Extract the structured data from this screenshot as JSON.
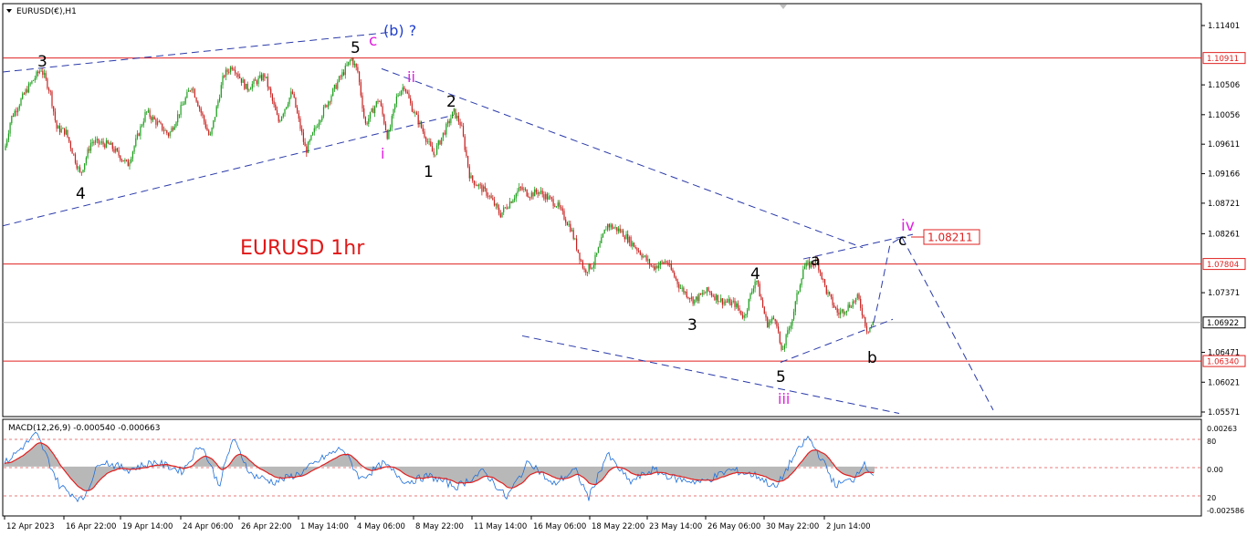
{
  "chart_data": {
    "type": "line",
    "title": "EURUSD(€),H1",
    "annotation_title": "EURUSD 1hr",
    "price_axis": {
      "ticks": [
        "1.11401",
        "1.10506",
        "1.10056",
        "1.09611",
        "1.09166",
        "1.08721",
        "1.08261",
        "1.07371",
        "1.06471",
        "1.06021",
        "1.05571"
      ],
      "ylim": [
        1.05571,
        1.11401
      ],
      "marked_levels": [
        {
          "label": "1.10911",
          "value": 1.10911,
          "color": "#e02020"
        },
        {
          "label": "1.07804",
          "value": 1.07804,
          "color": "#e02020"
        },
        {
          "label": "1.06922",
          "value": 1.06922,
          "color": "#000000"
        },
        {
          "label": "1.06340",
          "value": 1.0634,
          "color": "#e02020"
        }
      ],
      "target_label": "1.08211",
      "target_value": 1.08211
    },
    "time_axis": {
      "ticks": [
        "12 Apr 2023",
        "16 Apr 22:00",
        "19 Apr 14:00",
        "24 Apr 06:00",
        "26 Apr 22:00",
        "1 May 14:00",
        "4 May 06:00",
        "8 May 22:00",
        "11 May 14:00",
        "16 May 06:00",
        "18 May 22:00",
        "23 May 14:00",
        "26 May 06:00",
        "30 May 22:00",
        "2 Jun 14:00"
      ]
    },
    "price_anchors": {
      "x": [
        0,
        12,
        30,
        45,
        55,
        62,
        72,
        88,
        100,
        120,
        140,
        160,
        185,
        210,
        230,
        245,
        255,
        270,
        290,
        305,
        320,
        335,
        350,
        370,
        385,
        392,
        400,
        415,
        425,
        435,
        443,
        450,
        462,
        475,
        485,
        497,
        505,
        515,
        535,
        548,
        570,
        580,
        590,
        610,
        625,
        640,
        650,
        665,
        680,
        700,
        715,
        730,
        745,
        760,
        775,
        790,
        805,
        815,
        828,
        840,
        850,
        856,
        868,
        880,
        895,
        905,
        918,
        928,
        940,
        950,
        957
      ],
      "y": [
        1.0918,
        1.1,
        1.1045,
        1.1075,
        1.104,
        1.0985,
        1.098,
        1.0915,
        1.0965,
        1.096,
        1.093,
        1.101,
        1.0975,
        1.105,
        1.097,
        1.1065,
        1.108,
        1.1045,
        1.1065,
        1.0995,
        1.104,
        1.095,
        1.1,
        1.1055,
        1.109,
        1.107,
        1.099,
        1.103,
        1.097,
        1.1035,
        1.105,
        1.102,
        1.0985,
        1.0945,
        1.0975,
        1.101,
        1.099,
        1.091,
        1.0885,
        1.0855,
        1.0895,
        1.0885,
        1.089,
        1.087,
        1.0835,
        1.077,
        1.078,
        1.084,
        1.083,
        1.08,
        1.0775,
        1.0785,
        1.0745,
        1.0725,
        1.074,
        1.0725,
        1.072,
        1.07,
        1.076,
        1.069,
        1.07,
        1.0645,
        1.07,
        1.0775,
        1.0785,
        1.074,
        1.0705,
        1.0715,
        1.073,
        1.068,
        1.0692
      ]
    },
    "projection": {
      "y": [
        1.0692,
        1.0722,
        1.081,
        1.0821,
        1.056
      ]
    },
    "wave_labels": [
      {
        "text": "3",
        "color": "#000000"
      },
      {
        "text": "4",
        "color": "#000000"
      },
      {
        "text": "5",
        "color": "#000000"
      },
      {
        "text": "c",
        "color": "#e020e0"
      },
      {
        "text": "(b) ?",
        "color": "#1f3fcf"
      },
      {
        "text": "ii",
        "color": "#e020e0"
      },
      {
        "text": "i",
        "color": "#e020e0"
      },
      {
        "text": "2",
        "color": "#000000"
      },
      {
        "text": "1",
        "color": "#000000"
      },
      {
        "text": "3",
        "color": "#000000"
      },
      {
        "text": "4",
        "color": "#000000"
      },
      {
        "text": "5",
        "color": "#000000"
      },
      {
        "text": "iii",
        "color": "#e020e0"
      },
      {
        "text": "a",
        "color": "#000000"
      },
      {
        "text": "b",
        "color": "#000000"
      },
      {
        "text": "iv",
        "color": "#e020e0"
      },
      {
        "text": "c",
        "color": "#000000"
      }
    ],
    "macd": {
      "title": "MACD(12,26,9) -0.000540 -0.000663",
      "ticks": [
        "0.00263",
        "80",
        "0.00",
        "20",
        "-0.002586"
      ],
      "ylim": [
        -0.002586,
        0.00263
      ],
      "signal_color": "#e02020",
      "line_color": "#1e6fd9",
      "hist_color": "#b8b8b8",
      "anchors": {
        "x": [
          5,
          40,
          65,
          90,
          110,
          140,
          170,
          200,
          220,
          240,
          255,
          275,
          300,
          330,
          355,
          375,
          395,
          420,
          445,
          470,
          500,
          530,
          555,
          580,
          605,
          630,
          645,
          665,
          690,
          715,
          740,
          770,
          800,
          830,
          850,
          868,
          885,
          900,
          915,
          935,
          945,
          957
        ],
        "y": [
          0.0002,
          0.0021,
          -0.0012,
          -0.0022,
          0.0004,
          -0.0002,
          0.0003,
          -0.0003,
          0.0015,
          -0.0012,
          0.0018,
          -0.0005,
          -0.001,
          -0.0004,
          0.0006,
          0.0012,
          -0.0008,
          0.0002,
          -0.001,
          -0.0006,
          -0.0013,
          -0.0003,
          -0.002,
          0.0004,
          -0.0012,
          -0.0002,
          -0.002,
          0.0008,
          -0.001,
          -0.0002,
          -0.0008,
          -0.001,
          -0.0002,
          -0.0006,
          -0.0014,
          0.0005,
          0.0019,
          0.0005,
          -0.0012,
          -0.0008,
          0.0002,
          -0.0005
        ]
      }
    },
    "colors": {
      "up_candle": "#1a9e1a",
      "down_candle": "#c8201e",
      "level_line": "#e02020",
      "trendline": "#2a3aa8",
      "axis": "#000000"
    }
  }
}
